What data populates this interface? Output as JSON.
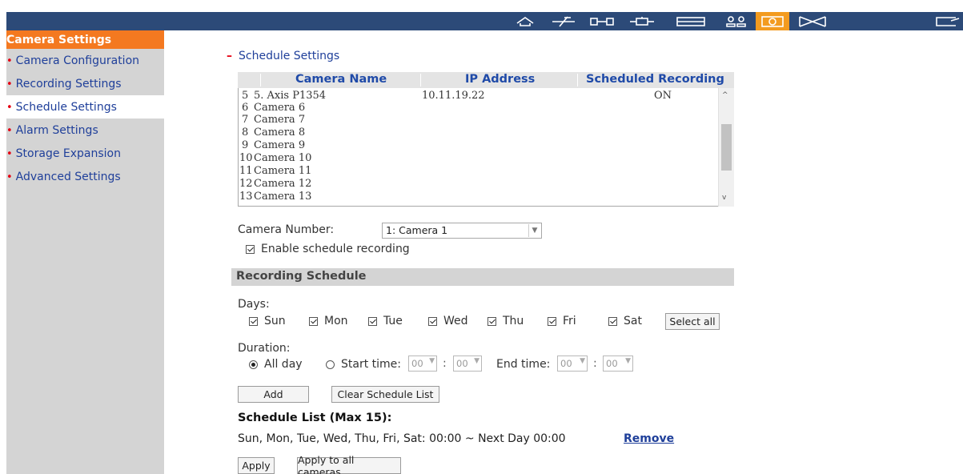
{
  "sidebar": {
    "title": "Camera Settings",
    "items": [
      {
        "label": "Camera Configuration"
      },
      {
        "label": "Recording Settings"
      },
      {
        "label": "Schedule Settings"
      },
      {
        "label": "Alarm Settings"
      },
      {
        "label": "Storage Expansion"
      },
      {
        "label": "Advanced Settings"
      }
    ],
    "active_index": 2,
    "bullet": "•"
  },
  "topbar": {
    "icons": [
      "home-icon",
      "plane-icon",
      "network-icon",
      "device-icon",
      "panel-icon",
      "users-icon",
      "camera-icon",
      "mail-icon",
      "exit-icon"
    ],
    "active_icon": "camera-icon",
    "accent_color": "#f39b1f",
    "bar_color": "#2c4a78"
  },
  "section": {
    "minus": "–",
    "title": "Schedule Settings"
  },
  "camera_table": {
    "headers": [
      "Camera Name",
      "IP Address",
      "Scheduled Recording"
    ],
    "rows": [
      {
        "no": "5",
        "name": "5. Axis P1354",
        "ip": "10.11.19.22",
        "sched": "ON"
      },
      {
        "no": "6",
        "name": "Camera 6",
        "ip": "",
        "sched": ""
      },
      {
        "no": "7",
        "name": "Camera 7",
        "ip": "",
        "sched": ""
      },
      {
        "no": "8",
        "name": "Camera 8",
        "ip": "",
        "sched": ""
      },
      {
        "no": "9",
        "name": "Camera 9",
        "ip": "",
        "sched": ""
      },
      {
        "no": "10",
        "name": "Camera 10",
        "ip": "",
        "sched": ""
      },
      {
        "no": "11",
        "name": "Camera 11",
        "ip": "",
        "sched": ""
      },
      {
        "no": "12",
        "name": "Camera 12",
        "ip": "",
        "sched": ""
      },
      {
        "no": "13",
        "name": "Camera 13",
        "ip": "",
        "sched": ""
      }
    ],
    "scroll_up": "^",
    "scroll_down": "v"
  },
  "camera_number": {
    "label": "Camera Number:",
    "value": "1: Camera 1"
  },
  "enable_schedule": {
    "label": "Enable schedule recording",
    "checked": true
  },
  "recording_schedule": {
    "header": "Recording Schedule",
    "days_label": "Days:",
    "days": [
      {
        "label": "Sun",
        "checked": true
      },
      {
        "label": "Mon",
        "checked": true
      },
      {
        "label": "Tue",
        "checked": true
      },
      {
        "label": "Wed",
        "checked": true
      },
      {
        "label": "Thu",
        "checked": true
      },
      {
        "label": "Fri",
        "checked": true
      },
      {
        "label": "Sat",
        "checked": true
      }
    ],
    "select_all": "Select all",
    "duration_label": "Duration:",
    "all_day": "All day",
    "start_time_label": "Start time:",
    "end_time_label": "End time:",
    "start_hour": "00",
    "start_min": "00",
    "end_hour": "00",
    "end_min": "00",
    "colon": ":",
    "selected_duration": "all_day"
  },
  "buttons": {
    "add": "Add",
    "clear": "Clear Schedule List",
    "apply": "Apply",
    "apply_all": "Apply to all cameras"
  },
  "schedule_list": {
    "title": "Schedule List (Max 15):",
    "entry": "Sun, Mon, Tue, Wed, Thu, Fri, Sat: 00:00 ~ Next Day 00:00",
    "remove": "Remove"
  }
}
